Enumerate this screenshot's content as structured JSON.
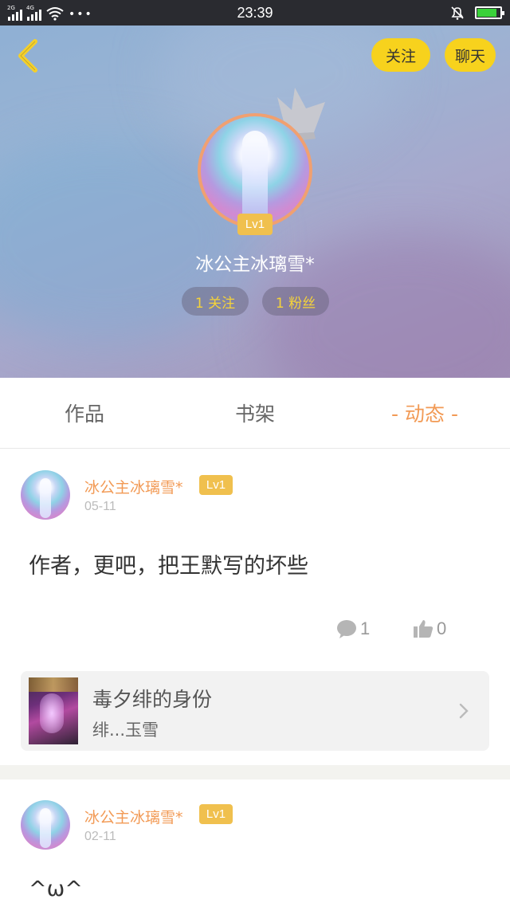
{
  "status_bar": {
    "net_a": "2G",
    "net_b": "4G",
    "time": "23:39"
  },
  "header": {
    "follow_label": "关注",
    "chat_label": "聊天",
    "level_badge": "Lv1",
    "username": "冰公主冰璃雪*",
    "following_label": "1 关注",
    "fans_label": "1 粉丝"
  },
  "tabs": [
    {
      "label": "作品"
    },
    {
      "label": "书架"
    },
    {
      "label": "- 动态 -",
      "active": true
    }
  ],
  "posts": [
    {
      "author": "冰公主冰璃雪*",
      "level": "Lv1",
      "date": "05-11",
      "text": "作者，更吧，把王默写的坏些",
      "comments": "1",
      "likes": "0",
      "book": {
        "title": "毒夕绯的身份",
        "author": "绯...玉雪"
      }
    },
    {
      "author": "冰公主冰璃雪*",
      "level": "Lv1",
      "date": "02-11",
      "text": "^ω^"
    }
  ],
  "colors": {
    "accent_orange": "#f29a55",
    "button_yellow": "#f7d21d",
    "level_gold": "#f0c04e"
  }
}
